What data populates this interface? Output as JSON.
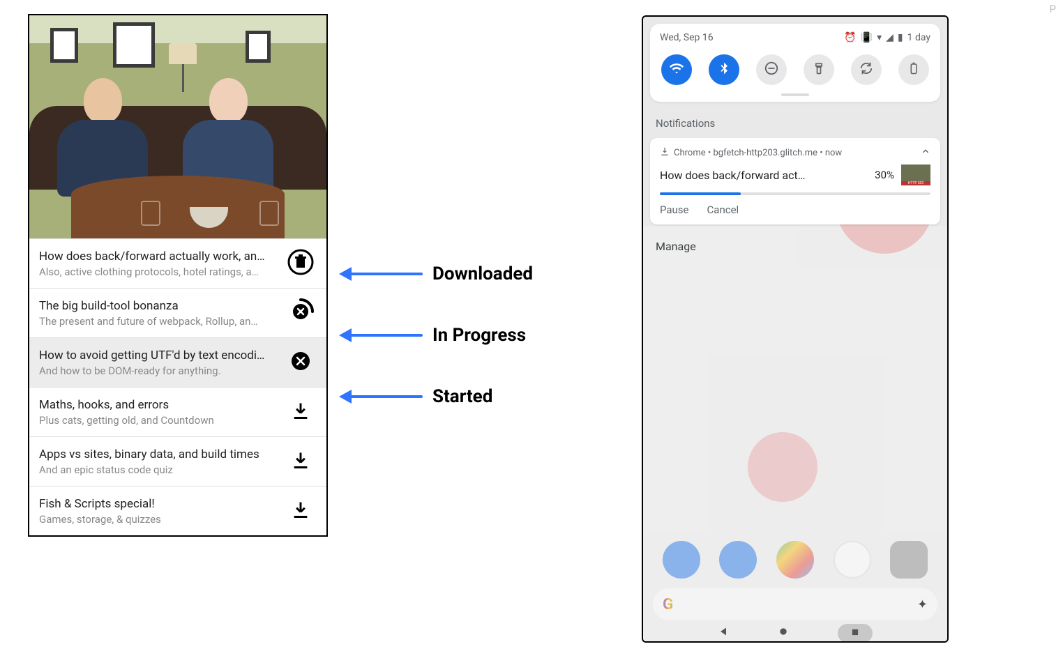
{
  "annotations": {
    "downloaded": "Downloaded",
    "in_progress": "In Progress",
    "started": "Started"
  },
  "colors": {
    "accent": "#1a73e8",
    "arrow": "#2f74ff"
  },
  "left_app": {
    "items": [
      {
        "title": "How does back/forward actually work, an…",
        "subtitle": "Also, active clothing protocols, hotel ratings, a…",
        "state": "downloaded",
        "highlight": false
      },
      {
        "title": "The big build-tool bonanza",
        "subtitle": "The present and future of webpack, Rollup, an…",
        "state": "in_progress",
        "highlight": false
      },
      {
        "title": "How to avoid getting UTF'd by text encodi…",
        "subtitle": "And how to be DOM-ready for anything.",
        "state": "started",
        "highlight": true
      },
      {
        "title": "Maths, hooks, and errors",
        "subtitle": "Plus cats, getting old, and Countdown",
        "state": "idle",
        "highlight": false
      },
      {
        "title": "Apps vs sites, binary data, and build times",
        "subtitle": "And an epic status code quiz",
        "state": "idle",
        "highlight": false
      },
      {
        "title": "Fish & Scripts special!",
        "subtitle": "Games, storage, & quizzes",
        "state": "idle",
        "highlight": false
      }
    ]
  },
  "right_phone": {
    "statusbar": {
      "date": "Wed, Sep 16",
      "battery_text": "1 day"
    },
    "quick_settings": [
      {
        "name": "wifi",
        "active": true
      },
      {
        "name": "bluetooth",
        "active": true
      },
      {
        "name": "dnd",
        "active": false
      },
      {
        "name": "flashlight",
        "active": false
      },
      {
        "name": "rotate",
        "active": false
      },
      {
        "name": "battery-saver",
        "active": false
      }
    ],
    "notifications_header": "Notifications",
    "notification": {
      "source": "Chrome  •  bgfetch-http203.glitch.me  •  now",
      "title": "How does back/forward act…",
      "percent_text": "30%",
      "percent_value": 30,
      "actions": {
        "pause": "Pause",
        "cancel": "Cancel"
      }
    },
    "manage": "Manage"
  }
}
